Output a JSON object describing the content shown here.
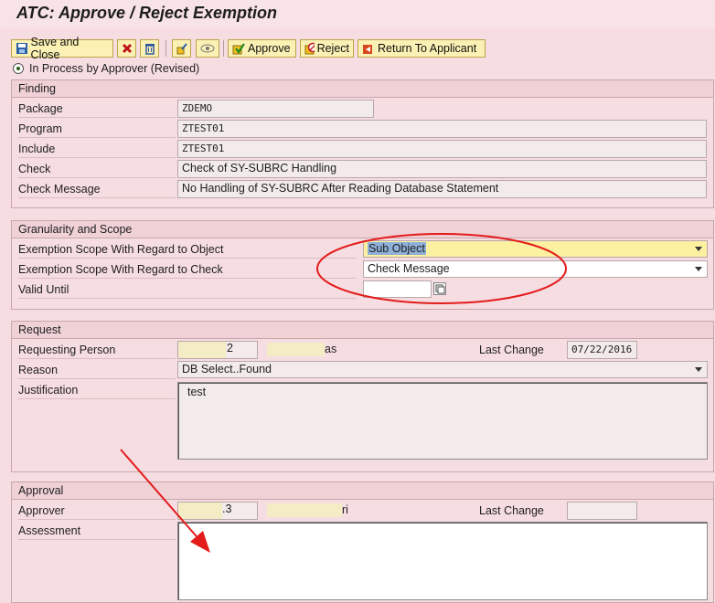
{
  "title": "ATC: Approve / Reject Exemption",
  "toolbar": {
    "save_close": "Save and Close",
    "approve": "Approve",
    "reject": "Reject",
    "return_to_applicant": "Return To Applicant"
  },
  "status": "In Process by Approver (Revised)",
  "finding": {
    "heading": "Finding",
    "package_label": "Package",
    "package_value": "ZDEMO",
    "program_label": "Program",
    "program_value": "ZTEST01",
    "include_label": "Include",
    "include_value": "ZTEST01",
    "check_label": "Check",
    "check_value": "Check of SY-SUBRC Handling",
    "message_label": "Check Message",
    "message_value": "No Handling of SY-SUBRC After Reading Database Statement"
  },
  "scope": {
    "heading": "Granularity and Scope",
    "object_label": "Exemption Scope With Regard to Object",
    "object_value": "Sub Object",
    "check_label": "Exemption Scope With Regard to Check",
    "check_value": "Check Message",
    "valid_label": "Valid Until",
    "valid_value": ""
  },
  "request": {
    "heading": "Request",
    "person_label": "Requesting Person",
    "person_id_tail": "2",
    "person_name_tail": "as",
    "last_change_label": "Last Change",
    "last_change_value": "07/22/2016",
    "reason_label": "Reason",
    "reason_value": "DB Select..Found",
    "justification_label": "Justification",
    "justification_value": "test"
  },
  "approval": {
    "heading": "Approval",
    "approver_label": "Approver",
    "approver_id_tail": ".3",
    "approver_name_tail": "ri",
    "last_change_label": "Last Change",
    "last_change_value": "",
    "assessment_label": "Assessment",
    "assessment_value": ""
  },
  "colors": {
    "annotation": "#e31b1b",
    "highlight_field": "#fbf1a0"
  }
}
